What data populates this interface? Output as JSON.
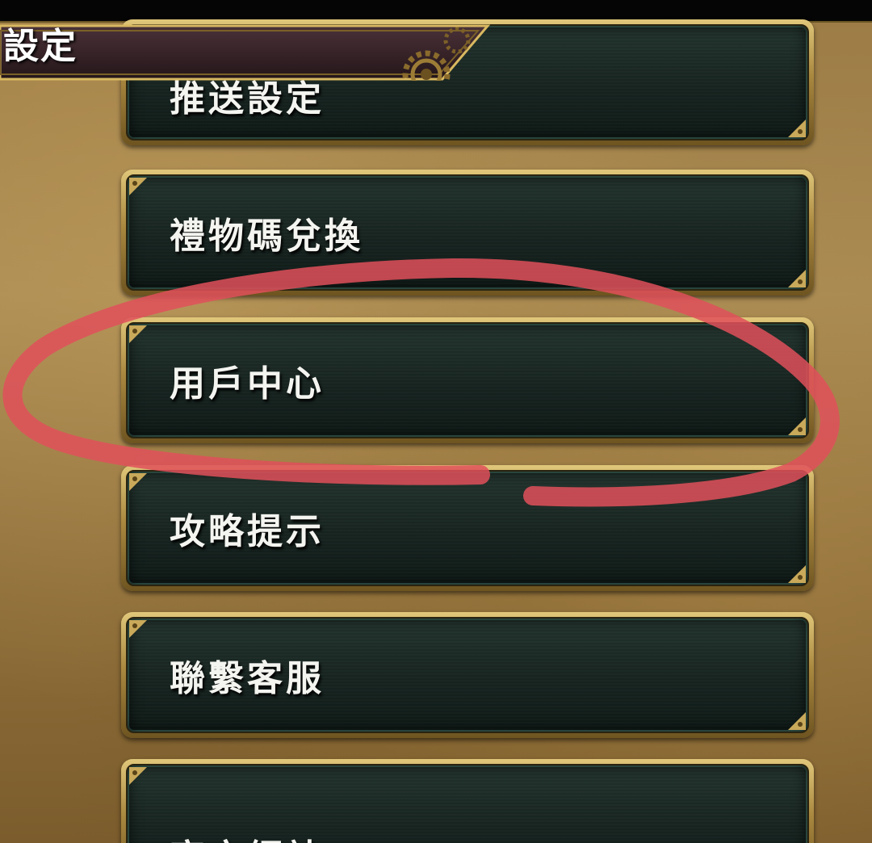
{
  "header": {
    "title": "設定",
    "gear_icon": "gear-icon"
  },
  "menu": {
    "items": [
      {
        "label": "推送設定"
      },
      {
        "label": "禮物碼兌換"
      },
      {
        "label": "用戶中心"
      },
      {
        "label": "攻略提示"
      },
      {
        "label": "聯繫客服"
      },
      {
        "label": "官方網站"
      }
    ]
  },
  "annotation": {
    "type": "hand-drawn circle",
    "target": "用戶中心",
    "color": "#e0505a"
  },
  "colors": {
    "button_frame": "#c9a95a",
    "button_fill": "#172420",
    "button_text": "#f4f4f0",
    "annotation": "#e0505a"
  }
}
